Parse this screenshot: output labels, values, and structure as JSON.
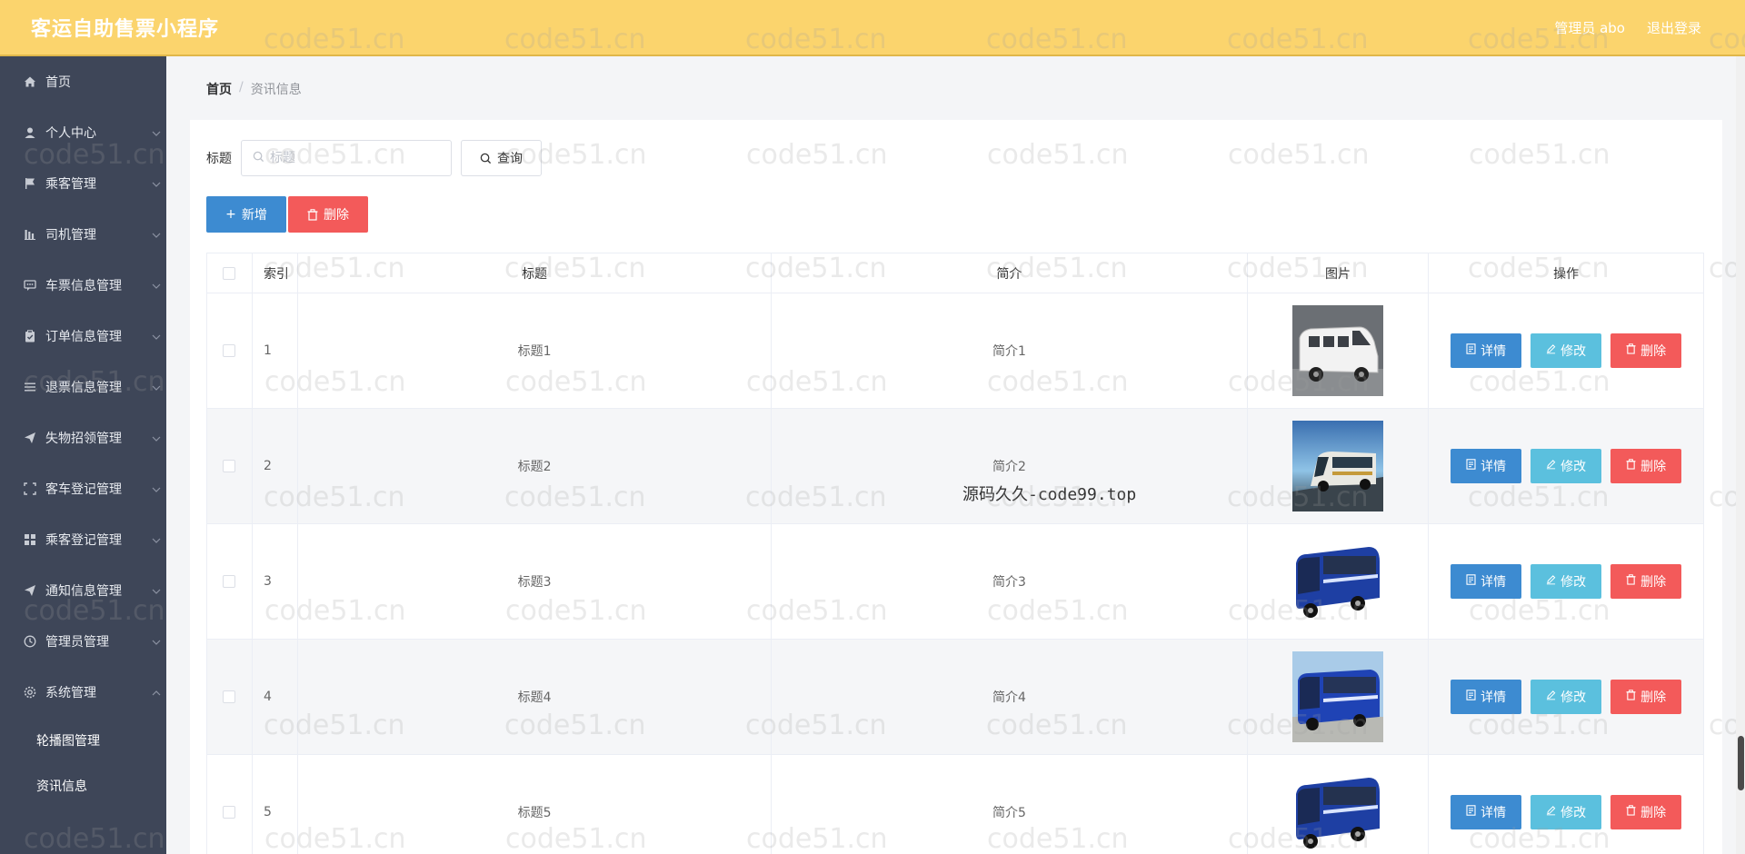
{
  "header": {
    "title": "客运自助售票小程序",
    "user_label": "管理员 abo",
    "logout_label": "退出登录"
  },
  "sidebar": {
    "items": [
      {
        "label": "首页",
        "icon": "home-icon",
        "has_children": false
      },
      {
        "label": "个人中心",
        "icon": "user-icon",
        "has_children": true
      },
      {
        "label": "乘客管理",
        "icon": "flag-icon",
        "has_children": true
      },
      {
        "label": "司机管理",
        "icon": "chart-icon",
        "has_children": true
      },
      {
        "label": "车票信息管理",
        "icon": "chat-icon",
        "has_children": true
      },
      {
        "label": "订单信息管理",
        "icon": "clipboard-icon",
        "has_children": true
      },
      {
        "label": "退票信息管理",
        "icon": "list-icon",
        "has_children": true
      },
      {
        "label": "失物招领管理",
        "icon": "send-icon",
        "has_children": true
      },
      {
        "label": "客车登记管理",
        "icon": "frame-icon",
        "has_children": true
      },
      {
        "label": "乘客登记管理",
        "icon": "grid-icon",
        "has_children": true
      },
      {
        "label": "通知信息管理",
        "icon": "send-icon",
        "has_children": true
      },
      {
        "label": "管理员管理",
        "icon": "clock-icon",
        "has_children": true
      },
      {
        "label": "系统管理",
        "icon": "gear-icon",
        "has_children": true,
        "expanded": true
      }
    ],
    "submenu": [
      "轮播图管理",
      "资讯信息"
    ]
  },
  "breadcrumb": {
    "home": "首页",
    "separator": "/",
    "current": "资讯信息"
  },
  "search": {
    "label": "标题",
    "placeholder": "标题",
    "query_label": "查询"
  },
  "actions": {
    "add_label": "新增",
    "delete_label": "删除"
  },
  "table": {
    "headers": {
      "index": "索引",
      "title": "标题",
      "intro": "简介",
      "image": "图片",
      "ops": "操作"
    },
    "rows": [
      {
        "index": "1",
        "title": "标题1",
        "intro": "简介1",
        "image": "white-van"
      },
      {
        "index": "2",
        "title": "标题2",
        "intro": "简介2",
        "image": "coach-road"
      },
      {
        "index": "3",
        "title": "标题3",
        "intro": "简介3",
        "image": "blue-bus"
      },
      {
        "index": "4",
        "title": "标题4",
        "intro": "简介4",
        "image": "blue-bus-sky"
      },
      {
        "index": "5",
        "title": "标题5",
        "intro": "简介5",
        "image": "blue-bus"
      }
    ],
    "op_labels": {
      "detail": "详情",
      "edit": "修改",
      "delete": "删除"
    }
  },
  "watermark": {
    "text": "code51.cn",
    "center_text": "源码久久-code99.top"
  },
  "colors": {
    "header_bg": "#fbd46d",
    "sidebar_bg": "#3e4658",
    "primary": "#3d8bd1",
    "info": "#5bc0de",
    "danger": "#f35a5a"
  }
}
